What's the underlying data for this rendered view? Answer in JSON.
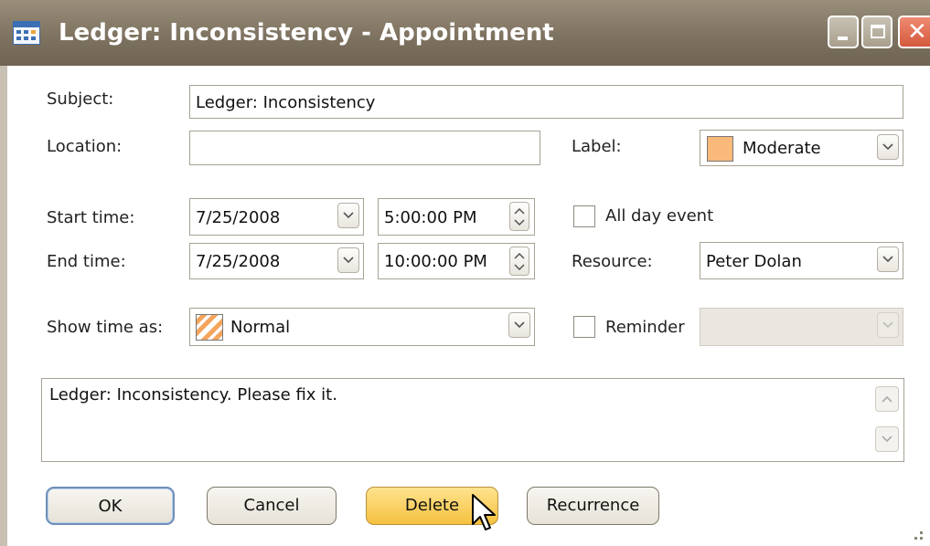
{
  "window": {
    "title": "Ledger: Inconsistency - Appointment",
    "icon": "calendar-icon",
    "controls": [
      "minimize-icon",
      "maximize-icon",
      "close-icon"
    ],
    "title_bar_color": "#7c705e"
  },
  "form": {
    "subject": {
      "label": "Subject:",
      "value": "Ledger: Inconsistency"
    },
    "location": {
      "label": "Location:",
      "value": ""
    },
    "label_select": {
      "label": "Label:",
      "value": "Moderate",
      "swatch_color": "#f9b97b"
    },
    "start": {
      "label": "Start time:",
      "date": "7/25/2008",
      "time": "5:00:00 PM"
    },
    "end": {
      "label": "End time:",
      "date": "7/25/2008",
      "time": "10:00:00 PM"
    },
    "all_day": {
      "label": "All day event",
      "checked": false
    },
    "resource": {
      "label": "Resource:",
      "value": "Peter Dolan"
    },
    "show_time_as": {
      "label": "Show time as:",
      "value": "Normal",
      "swatch_color": "#f5a45b"
    },
    "reminder": {
      "label": "Reminder",
      "checked": false,
      "value": ""
    },
    "description": "Ledger: Inconsistency. Please fix it."
  },
  "buttons": {
    "ok": "OK",
    "cancel": "Cancel",
    "delete": "Delete",
    "recurrence": "Recurrence"
  },
  "colors": {
    "delete_button": "#f5c13f",
    "ok_focus_border": "#6f8fb7"
  }
}
